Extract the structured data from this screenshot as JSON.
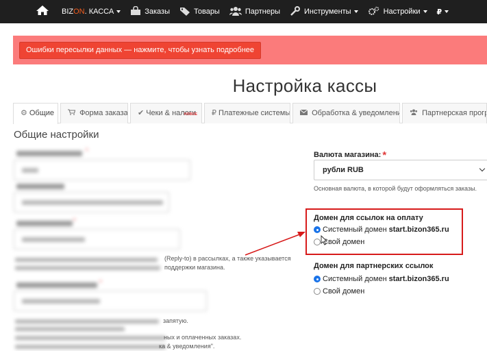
{
  "navbar": {
    "brand_prefix": "BIZ",
    "brand_accent": "ON",
    "brand_suffix": ". КАССА",
    "items": [
      {
        "label": "Заказы",
        "icon": "shopping-bag-icon"
      },
      {
        "label": "Товары",
        "icon": "tag-icon"
      },
      {
        "label": "Партнеры",
        "icon": "users-icon"
      },
      {
        "label": "Инструменты",
        "icon": "wrench-icon"
      },
      {
        "label": "Настройки",
        "icon": "gears-icon"
      },
      {
        "label": "₽",
        "icon": "ruble-icon"
      }
    ]
  },
  "error_banner": {
    "text": "Ошибки пересылки данных — нажмите, чтобы узнать подробнее"
  },
  "page_title": "Настройка кассы",
  "tabs": [
    {
      "label": "Общие",
      "icon": "gears-icon",
      "active": true
    },
    {
      "label": "Форма заказа",
      "icon": "cart-icon",
      "active": false
    },
    {
      "label": "Чеки & налоги",
      "icon": "check-icon",
      "active": false,
      "badge": "НОВОЕ"
    },
    {
      "label": "Платежные системы",
      "icon": "ruble-icon",
      "active": false
    },
    {
      "label": "Обработка & уведомления",
      "icon": "envelope-icon",
      "active": false
    },
    {
      "label": "Партнерская програм",
      "icon": "users-icon",
      "active": false
    }
  ],
  "section_title": "Общие настройки",
  "left_help": {
    "reply_to": "(Reply-to) в рассылках, а также указывается",
    "support": "поддержки магазина.",
    "comma": "запятую.",
    "paid_orders": "ных и оплаченных заказах.",
    "notifications": "ка & уведомления\"."
  },
  "currency": {
    "label": "Валюта магазина:",
    "required_mark": "*",
    "value": "рубли RUB",
    "help": "Основная валюта, в которой будут оформляться заказы."
  },
  "payment_domain": {
    "label": "Домен для ссылок на оплату",
    "option_system_prefix": "Системный домен",
    "option_system_domain": "start.bizon365.ru",
    "option_own": "Свой домен",
    "selected": "system"
  },
  "partner_domain": {
    "label": "Домен для партнерских ссылок",
    "option_system_prefix": "Системный домен",
    "option_system_domain": "start.bizon365.ru",
    "option_own": "Свой домен",
    "selected": "system"
  },
  "colors": {
    "navbar_bg": "#1f1f1f",
    "brand_accent": "#f25c1e",
    "error_strip": "#fb7b7b",
    "error_button": "#ef4433",
    "radio_checked": "#1a73e8",
    "annotation_red": "#d71a1a"
  }
}
